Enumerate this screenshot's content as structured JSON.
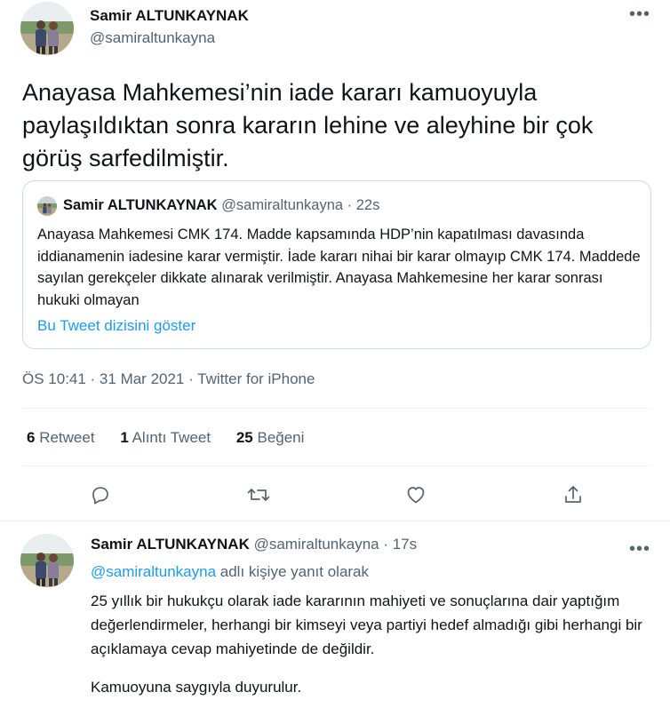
{
  "main_tweet": {
    "author_name": "Samir ALTUNKAYNAK",
    "author_handle": "@samiraltunkayna",
    "more_icon": "more-horizontal-icon",
    "text": "Anayasa Mahkemesi’nin iade kararı kamuoyuyla paylaşıldıktan sonra kararın lehine  ve aleyhine  bir çok görüş sarfedilmiştir.",
    "quoted_tweet": {
      "author_name": "Samir ALTUNKAYNAK",
      "meta": "@samiraltunkayna · 22s",
      "text": "Anayasa Mahkemesi CMK 174. Madde kapsamında HDP’nin kapatılması davasında iddianamenin iadesine karar vermiştir. İade kararı nihai bir karar olmayıp CMK 174. Maddede sayılan gerekçeler dikkate alınarak verilmiştir. Anayasa Mahkemesine her karar sonrası hukuki olmayan",
      "show_thread": "Bu Tweet dizisini göster"
    },
    "timestamp": "ÖS 10:41 · 31 Mar 2021 · Twitter for iPhone",
    "stats": {
      "retweets_count": "6",
      "retweets_label": "Retweet",
      "quotes_count": "1",
      "quotes_label": "Alıntı Tweet",
      "likes_count": "25",
      "likes_label": "Beğeni"
    },
    "actions": [
      "reply-icon",
      "retweet-icon",
      "like-icon",
      "share-icon"
    ]
  },
  "reply_tweet": {
    "author_name": "Samir ALTUNKAYNAK",
    "meta": "@samiraltunkayna · 17s",
    "reply_mention": "@samiraltunkayna",
    "reply_suffix": " adlı kişiye yanıt olarak",
    "text_paragraph_1": "25 yıllık bir hukukçu olarak iade kararının mahiyeti ve sonuçlarına dair yaptığım değerlendirmeler, herhangi bir kimseyi veya partiyi hedef almadığı gibi herhangi bir açıklamaya cevap mahiyetinde de değildir.",
    "text_paragraph_2": "Kamuoyuna saygıyla duyurulur."
  },
  "colors": {
    "accent": "#1d9bf0",
    "text_primary": "#0f1419",
    "text_secondary": "#536471",
    "border": "#cfd9de"
  }
}
